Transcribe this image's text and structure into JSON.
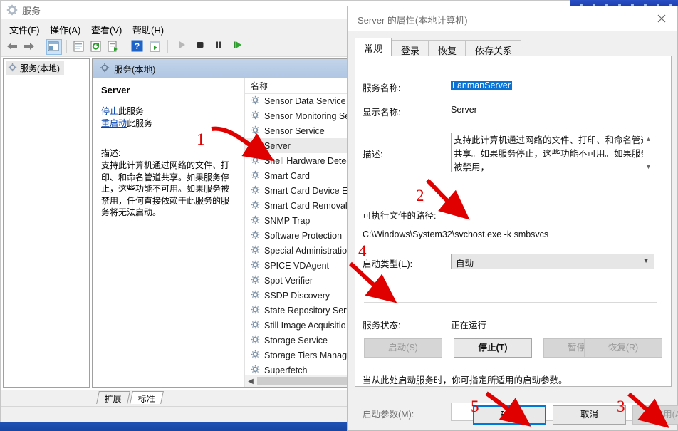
{
  "services_window": {
    "title": "服务",
    "title_icon": "gear-icon",
    "menu": [
      {
        "label": "文件(F)"
      },
      {
        "label": "操作(A)"
      },
      {
        "label": "查看(V)"
      },
      {
        "label": "帮助(H)"
      }
    ],
    "toolbar_icons": [
      "back-arrow-icon",
      "forward-arrow-icon",
      "show-hide-tree-icon",
      "properties-icon",
      "refresh-icon",
      "export-list-icon",
      "help-icon",
      "show-console-icon",
      "start-service-icon",
      "stop-service-icon",
      "pause-service-icon",
      "restart-service-icon"
    ],
    "window_buttons": [
      "minimize-button",
      "maximize-button",
      "close-button"
    ],
    "tree_root": "服务(本地)",
    "right_header": "服务(本地)",
    "detail": {
      "name": "Server",
      "stop_link_underlined": "停止",
      "stop_link_rest": "此服务",
      "restart_link_underlined": "重启动",
      "restart_link_rest": "此服务",
      "desc_label": "描述:",
      "desc_text": "支持此计算机通过网络的文件、打印、和命名管道共享。如果服务停止，这些功能不可用。如果服务被禁用，任何直接依赖于此服务的服务将无法启动。"
    },
    "list": {
      "columns": [
        "名称"
      ],
      "rows": [
        {
          "name": "Sensor Data Service",
          "selected": false
        },
        {
          "name": "Sensor Monitoring Se",
          "selected": false
        },
        {
          "name": "Sensor Service",
          "selected": false
        },
        {
          "name": "Server",
          "selected": true
        },
        {
          "name": "Shell Hardware Detec",
          "selected": false
        },
        {
          "name": "Smart Card",
          "selected": false
        },
        {
          "name": "Smart Card Device Er",
          "selected": false
        },
        {
          "name": "Smart Card Removal",
          "selected": false
        },
        {
          "name": "SNMP Trap",
          "selected": false
        },
        {
          "name": "Software Protection",
          "selected": false
        },
        {
          "name": "Special Administratio",
          "selected": false
        },
        {
          "name": "SPICE VDAgent",
          "selected": false
        },
        {
          "name": "Spot Verifier",
          "selected": false
        },
        {
          "name": "SSDP Discovery",
          "selected": false
        },
        {
          "name": "State Repository Serv",
          "selected": false
        },
        {
          "name": "Still Image Acquisitio",
          "selected": false
        },
        {
          "name": "Storage Service",
          "selected": false
        },
        {
          "name": "Storage Tiers Manag",
          "selected": false
        },
        {
          "name": "Superfetch",
          "selected": false
        }
      ]
    },
    "bottom_tabs": [
      {
        "label": "扩展",
        "active": false
      },
      {
        "label": "标准",
        "active": true
      }
    ]
  },
  "properties_dialog": {
    "title": "Server 的属性(本地计算机)",
    "close_icon": "close-icon",
    "tabs": [
      {
        "label": "常规",
        "active": true
      },
      {
        "label": "登录",
        "active": false
      },
      {
        "label": "恢复",
        "active": false
      },
      {
        "label": "依存关系",
        "active": false
      }
    ],
    "fields": {
      "service_name_label": "服务名称:",
      "service_name_value": "LanmanServer",
      "display_name_label": "显示名称:",
      "display_name_value": "Server",
      "description_label": "描述:",
      "description_value": "支持此计算机通过网络的文件、打印、和命名管道共享。如果服务停止，这些功能不可用。如果服务被禁用，",
      "path_label": "可执行文件的路径:",
      "path_value": "C:\\Windows\\System32\\svchost.exe -k smbsvcs",
      "startup_type_label": "启动类型(E):",
      "startup_type_value": "自动",
      "status_label": "服务状态:",
      "status_value": "正在运行",
      "hint_text": "当从此处启动服务时，你可指定所适用的启动参数。",
      "params_label": "启动参数(M):",
      "params_value": ""
    },
    "action_buttons": [
      {
        "label": "启动(S)",
        "enabled": false
      },
      {
        "label": "停止(T)",
        "enabled": true
      },
      {
        "label": "暂停(P)",
        "enabled": false
      },
      {
        "label": "恢复(R)",
        "enabled": false
      }
    ],
    "dialog_buttons": {
      "ok": "确定",
      "cancel": "取消",
      "apply": "应用(A)"
    }
  },
  "annotations": {
    "markers": [
      {
        "num": "1"
      },
      {
        "num": "2"
      },
      {
        "num": "3"
      },
      {
        "num": "4"
      },
      {
        "num": "5"
      }
    ],
    "color": "#e00000"
  }
}
